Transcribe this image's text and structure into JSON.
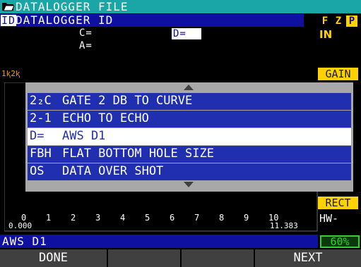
{
  "title_bar": {
    "title": "DATALOGGER FILE",
    "icon": "folder-icon"
  },
  "id_row": {
    "tag": "ID",
    "label": "DATALOGGER ID",
    "flags": [
      "F",
      "Z",
      "P"
    ]
  },
  "info": {
    "c_label": "C=",
    "d_label": "D=",
    "a_label": "A=",
    "r_icons": "1ⱪ2ⱪ"
  },
  "side_panel": {
    "in_label": "IN",
    "gain_label": "GAIN",
    "rect_label": "RECT",
    "hw_label": "HW-"
  },
  "axis": {
    "ticks": [
      "0",
      "1",
      "2",
      "3",
      "4",
      "5",
      "6",
      "7",
      "8",
      "9",
      "10"
    ],
    "x_min": "0.000",
    "x_max": "11.383"
  },
  "popup": {
    "items": [
      {
        "code": "2₂C",
        "text": "GATE 2 DB TO CURVE",
        "state": "normal"
      },
      {
        "code": "2-1",
        "text": "ECHO TO ECHO",
        "state": "normal"
      },
      {
        "code": "D=",
        "text": "AWS D1",
        "state": "selected"
      },
      {
        "code": "FBH",
        "text": "FLAT BOTTOM HOLE SIZE",
        "state": "normal"
      },
      {
        "code": "OS",
        "text": "DATA OVER SHOT",
        "state": "normal"
      }
    ]
  },
  "status": {
    "text": "AWS D1",
    "percent": "60%"
  },
  "softkeys": {
    "left": "DONE",
    "right": "NEXT"
  },
  "colors": {
    "title_bg": "#1aa6a6",
    "blue": "#1010a0",
    "list_blue": "#1f2fb0",
    "yellow": "#ffd200",
    "green": "#2fd02f"
  }
}
